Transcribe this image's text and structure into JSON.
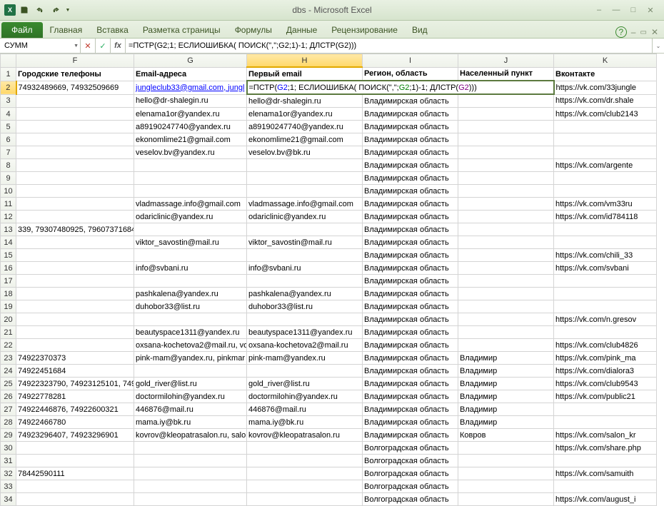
{
  "title": "dbs  -  Microsoft Excel",
  "file_tab": "Файл",
  "tabs": [
    "Главная",
    "Вставка",
    "Разметка страницы",
    "Формулы",
    "Данные",
    "Рецензирование",
    "Вид"
  ],
  "name_box": "СУММ",
  "formula": "=ПСТР(G2;1; ЕСЛИОШИБКА( ПОИСК(\",\";G2;1)-1; ДЛСТР(G2)))",
  "formula_tokens": [
    {
      "t": "=ПСТР("
    },
    {
      "t": "G2",
      "c": "tok-ref1"
    },
    {
      "t": ";1; ЕСЛИОШИБКА( ПОИСК(\",\";"
    },
    {
      "t": "G2",
      "c": "tok-ref2"
    },
    {
      "t": ";1)-1; ДЛСТР("
    },
    {
      "t": "G2",
      "c": "tok-ref3"
    },
    {
      "t": ")))"
    }
  ],
  "columns": [
    "F",
    "G",
    "H",
    "I",
    "J",
    "K"
  ],
  "headers": {
    "F": "Городские телефоны",
    "G": "Email-адреса",
    "H": "Первый email",
    "I": "Регион, область",
    "J": "Населенный пункт",
    "K": "Вконтакте"
  },
  "active": {
    "col": "H",
    "row": 2
  },
  "edit_overflow": "=ПСТР(G2;1; ЕСЛИОШИБКА( ПОИСК(\",\";G2;1)-1; ДЛСТР(G2)))",
  "rows": [
    {
      "n": 2,
      "F": "74932489669, 74932509669",
      "G": "jungleclub33@gmail.com, jungl",
      "H": "",
      "I": "",
      "J": "",
      "K": "https://vk.com/33jungle"
    },
    {
      "n": 3,
      "F": "",
      "G": "hello@dr-shalegin.ru",
      "H": "hello@dr-shalegin.ru",
      "I": "Владимирская область",
      "J": "",
      "K": "https://vk.com/dr.shale"
    },
    {
      "n": 4,
      "F": "",
      "G": "elenama1or@yandex.ru",
      "H": "elenama1or@yandex.ru",
      "I": "Владимирская область",
      "J": "",
      "K": "https://vk.com/club2143"
    },
    {
      "n": 5,
      "F": "",
      "G": "a89190247740@yandex.ru",
      "H": "a89190247740@yandex.ru",
      "I": "Владимирская область",
      "J": "",
      "K": ""
    },
    {
      "n": 6,
      "F": "",
      "G": "ekonomlime21@gmail.com",
      "H": "ekonomlime21@gmail.com",
      "I": "Владимирская область",
      "J": "",
      "K": ""
    },
    {
      "n": 7,
      "F": "",
      "G": "veselov.bv@yandex.ru",
      "H": "veselov.bv@bk.ru",
      "I": "Владимирская область",
      "J": "",
      "K": ""
    },
    {
      "n": 8,
      "F": "",
      "G": "",
      "H": "",
      "I": "Владимирская область",
      "J": "",
      "K": "https://vk.com/argente"
    },
    {
      "n": 9,
      "F": "",
      "G": "",
      "H": "",
      "I": "Владимирская область",
      "J": "",
      "K": ""
    },
    {
      "n": 10,
      "F": "",
      "G": "",
      "H": "",
      "I": "Владимирская область",
      "J": "",
      "K": ""
    },
    {
      "n": 11,
      "F": "",
      "G": "vladmassage.info@gmail.com",
      "H": "vladmassage.info@gmail.com",
      "I": "Владимирская область",
      "J": "",
      "K": "https://vk.com/vm33ru"
    },
    {
      "n": 12,
      "F": "",
      "G": "odariclinic@yandex.ru",
      "H": "odariclinic@yandex.ru",
      "I": "Владимирская область",
      "J": "",
      "K": "https://vk.com/id784118"
    },
    {
      "n": 13,
      "F": "339, 79307480925, 79607371684",
      "G": "",
      "H": "",
      "I": "Владимирская область",
      "J": "",
      "K": ""
    },
    {
      "n": 14,
      "F": "",
      "G": "viktor_savostin@mail.ru",
      "H": "viktor_savostin@mail.ru",
      "I": "Владимирская область",
      "J": "",
      "K": ""
    },
    {
      "n": 15,
      "F": "",
      "G": "",
      "H": "",
      "I": "Владимирская область",
      "J": "",
      "K": "https://vk.com/chili_33"
    },
    {
      "n": 16,
      "F": "",
      "G": "info@svbani.ru",
      "H": "info@svbani.ru",
      "I": "Владимирская область",
      "J": "",
      "K": "https://vk.com/svbani"
    },
    {
      "n": 17,
      "F": "",
      "G": "",
      "H": "",
      "I": "Владимирская область",
      "J": "",
      "K": ""
    },
    {
      "n": 18,
      "F": "",
      "G": "pashkalena@yandex.ru",
      "H": "pashkalena@yandex.ru",
      "I": "Владимирская область",
      "J": "",
      "K": ""
    },
    {
      "n": 19,
      "F": "",
      "G": "duhobor33@list.ru",
      "H": "duhobor33@list.ru",
      "I": "Владимирская область",
      "J": "",
      "K": ""
    },
    {
      "n": 20,
      "F": "",
      "G": "",
      "H": "",
      "I": "Владимирская область",
      "J": "",
      "K": "https://vk.com/n.gresov"
    },
    {
      "n": 21,
      "F": "",
      "G": "beautyspace1311@yandex.ru",
      "H": "beautyspace1311@yandex.ru",
      "I": "Владимирская область",
      "J": "",
      "K": ""
    },
    {
      "n": 22,
      "F": "",
      "G": "oxsana-kochetova2@mail.ru, vo",
      "H": "oxsana-kochetova2@mail.ru",
      "I": "Владимирская область",
      "J": "",
      "K": "https://vk.com/club4826"
    },
    {
      "n": 23,
      "F": "74922370373",
      "G": "pink-mam@yandex.ru, pinkmar",
      "H": "pink-mam@yandex.ru",
      "I": "Владимирская область",
      "J": "Владимир",
      "K": "https://vk.com/pink_ma"
    },
    {
      "n": 24,
      "F": "74922451684",
      "G": "",
      "H": "",
      "I": "Владимирская область",
      "J": "Владимир",
      "K": "https://vk.com/dialora3"
    },
    {
      "n": 25,
      "F": "74922323790, 74923125101, 7492",
      "G": "gold_river@list.ru",
      "H": "gold_river@list.ru",
      "I": "Владимирская область",
      "J": "Владимир",
      "K": "https://vk.com/club9543"
    },
    {
      "n": 26,
      "F": "74922778281",
      "G": "doctormilohin@yandex.ru",
      "H": "doctormilohin@yandex.ru",
      "I": "Владимирская область",
      "J": "Владимир",
      "K": "https://vk.com/public21"
    },
    {
      "n": 27,
      "F": "74922446876, 74922600321",
      "G": "446876@mail.ru",
      "H": "446876@mail.ru",
      "I": "Владимирская область",
      "J": "Владимир",
      "K": ""
    },
    {
      "n": 28,
      "F": "74922466780",
      "G": "mama.iy@bk.ru",
      "H": "mama.iy@bk.ru",
      "I": "Владимирская область",
      "J": "Владимир",
      "K": ""
    },
    {
      "n": 29,
      "F": "74923296407, 74923296901",
      "G": "kovrov@kleopatrasalon.ru, salo",
      "H": "kovrov@kleopatrasalon.ru",
      "I": "Владимирская область",
      "J": "Ковров",
      "K": "https://vk.com/salon_kr"
    },
    {
      "n": 30,
      "F": "",
      "G": "",
      "H": "",
      "I": "Волгоградская область",
      "J": "",
      "K": "https://vk.com/share.php"
    },
    {
      "n": 31,
      "F": "",
      "G": "",
      "H": "",
      "I": "Волгоградская область",
      "J": "",
      "K": ""
    },
    {
      "n": 32,
      "F": "78442590111",
      "G": "",
      "H": "",
      "I": "Волгоградская область",
      "J": "",
      "K": "https://vk.com/samuith"
    },
    {
      "n": 33,
      "F": "",
      "G": "",
      "H": "",
      "I": "Волгоградская область",
      "J": "",
      "K": ""
    },
    {
      "n": 34,
      "F": "",
      "G": "",
      "H": "",
      "I": "Волгоградская область",
      "J": "",
      "K": "https://vk.com/august_i"
    }
  ]
}
